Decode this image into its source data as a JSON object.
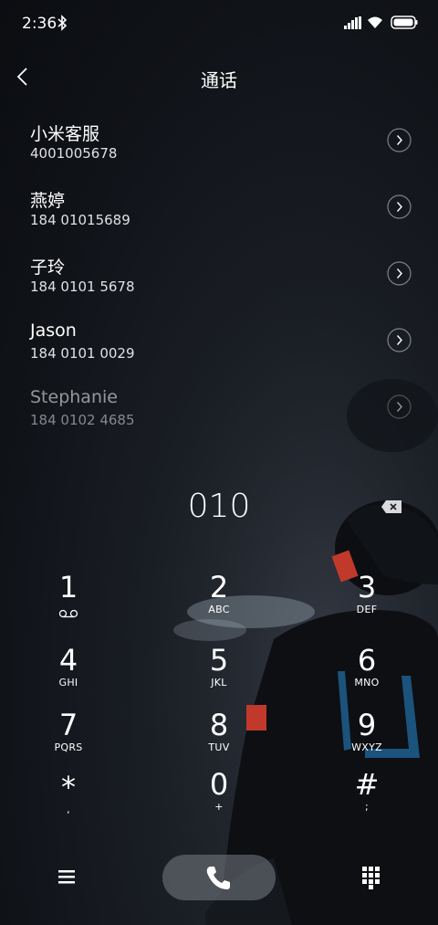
{
  "status_bar": {
    "time": "2:36"
  },
  "header": {
    "title": "通话"
  },
  "contacts": [
    {
      "name": "小米客服",
      "number": "4001005678"
    },
    {
      "name": "燕婷",
      "number": "184 01015689"
    },
    {
      "name": "子玲",
      "number": "184 0101 5678"
    },
    {
      "name": "Jason",
      "number": "184 0101 0029"
    },
    {
      "name": "Stephanie",
      "number": "184 0102 4685"
    }
  ],
  "dialer": {
    "number": "010"
  },
  "keys": [
    {
      "digit": "1",
      "sub": ""
    },
    {
      "digit": "2",
      "sub": "ABC"
    },
    {
      "digit": "3",
      "sub": "DEF"
    },
    {
      "digit": "4",
      "sub": "GHI"
    },
    {
      "digit": "5",
      "sub": "JKL"
    },
    {
      "digit": "6",
      "sub": "MNO"
    },
    {
      "digit": "7",
      "sub": "PQRS"
    },
    {
      "digit": "8",
      "sub": "TUV"
    },
    {
      "digit": "9",
      "sub": "WXYZ"
    },
    {
      "digit": "*",
      "sub": ","
    },
    {
      "digit": "0",
      "sub": "+"
    },
    {
      "digit": "#",
      "sub": ";"
    }
  ],
  "icons": {
    "status": [
      "bluetooth-icon",
      "signal-icon",
      "wifi-icon",
      "battery-icon"
    ],
    "header": [
      "back-icon"
    ],
    "contact_row": "chevron-right-icon",
    "dialer": [
      "backspace-icon",
      "voicemail-icon"
    ],
    "bottom_bar": [
      "menu-icon",
      "phone-icon",
      "dialpad-grid-icon"
    ]
  },
  "colors": {
    "background": "#14171c",
    "text": "#ffffff",
    "call_button": "#6e737b"
  }
}
